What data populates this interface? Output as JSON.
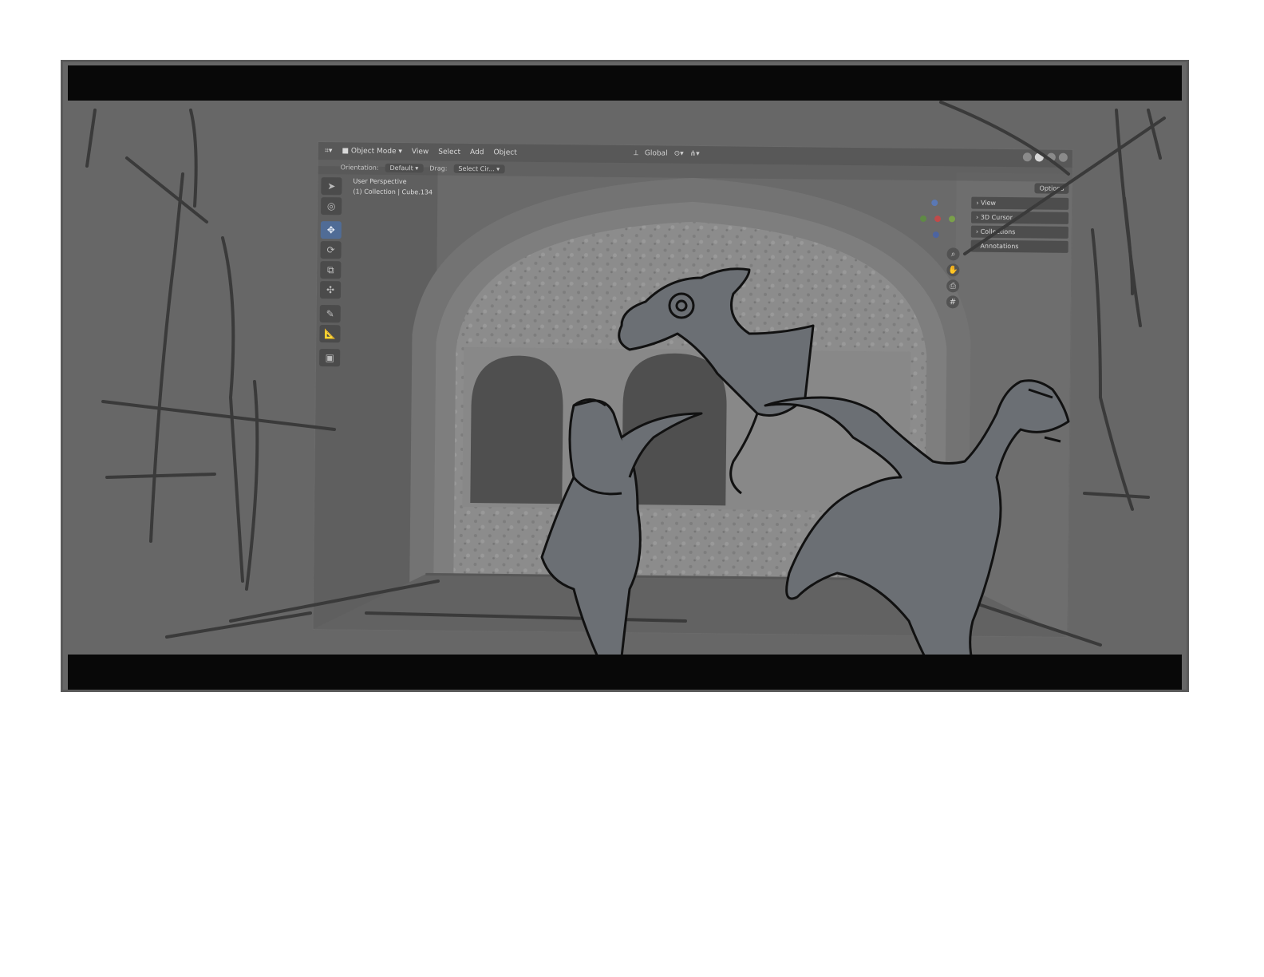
{
  "viewport": {
    "header": {
      "mode_label": "Object Mode",
      "menu_view": "View",
      "menu_select": "Select",
      "menu_add": "Add",
      "menu_object": "Object",
      "transform_orientation": "Global"
    },
    "subheader": {
      "orientation_label": "Orientation:",
      "orientation_value": "Default",
      "drag_label": "Drag:",
      "drag_value": "Select Cir..."
    },
    "overlay": {
      "line1": "User Perspective",
      "line2": "(1) Collection | Cube.134"
    },
    "options_label": "Options",
    "npanel": [
      "View",
      "3D Cursor",
      "Collections",
      "Annotations"
    ],
    "toolbar_icons": [
      "select-cursor-icon",
      "cursor-icon",
      "move-icon",
      "rotate-icon",
      "scale-icon",
      "transform-icon",
      "annotate-icon",
      "measure-icon",
      "add-cube-icon"
    ],
    "nav_icons": [
      "zoom-icon",
      "hand-icon",
      "camera-icon",
      "grid-icon"
    ]
  },
  "colors": {
    "frame_bg": "#676767",
    "letterbox": "#080808",
    "active_tool": "#506c96",
    "sketch_line": "#111111",
    "dino_fill": "#6b6f74"
  }
}
